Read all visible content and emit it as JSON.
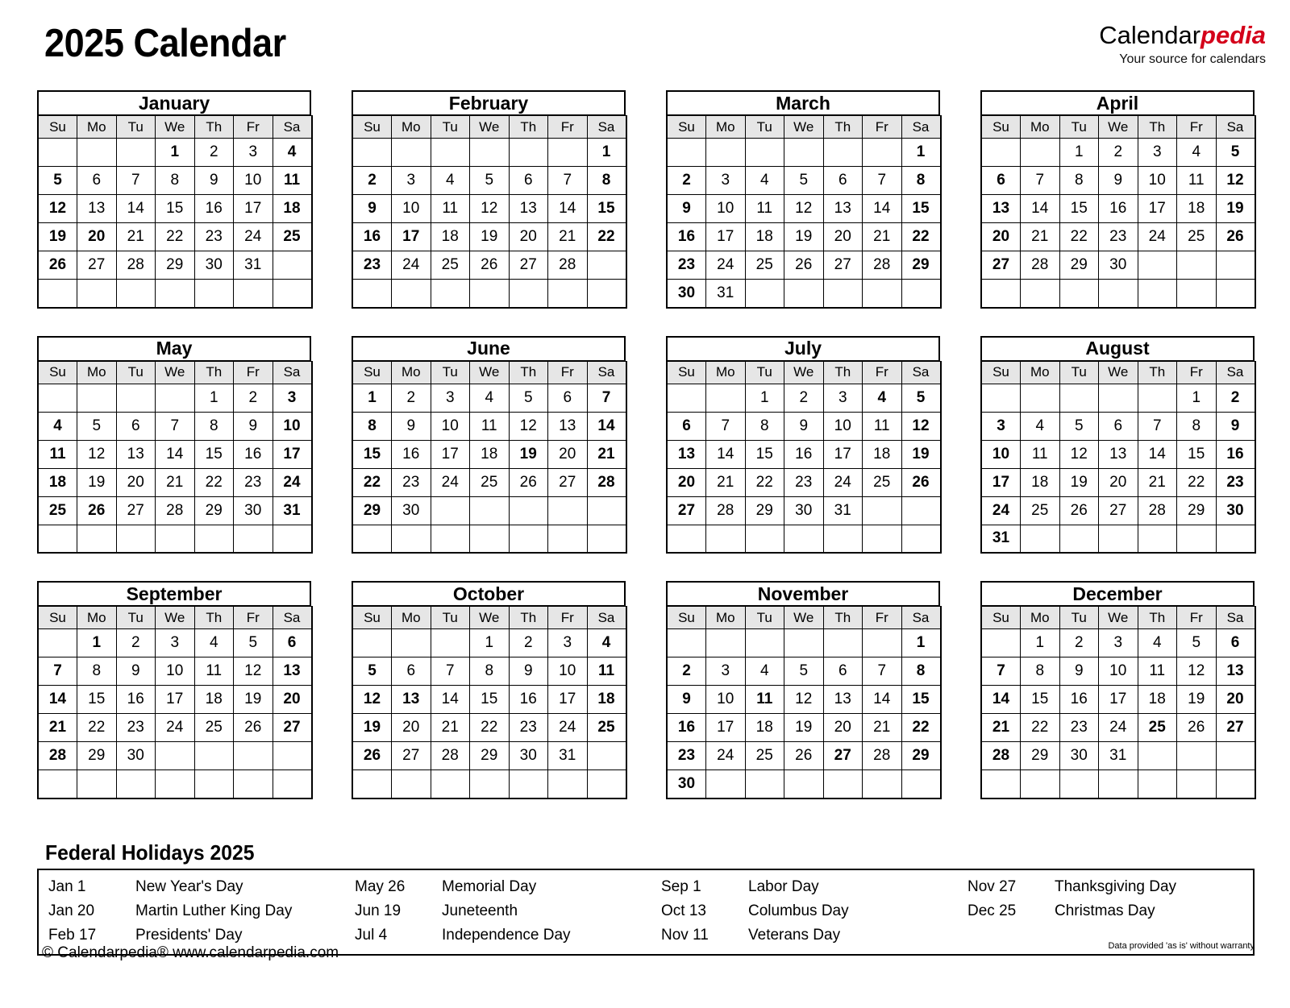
{
  "header": {
    "title": "2025 Calendar",
    "brand_primary": "Calendar",
    "brand_accent": "pedia",
    "brand_tagline": "Your source for calendars",
    "accent_color": "#d4001a"
  },
  "style_colors": {
    "sunday_bg": "#fac893",
    "saturday_bg": "#faf8d6",
    "weekday_header_bg": "#e6e6e6",
    "holiday_bg": "#fcdede",
    "holiday_text": "#cc0000",
    "border": "#000000"
  },
  "weekday_headers": [
    "Su",
    "Mo",
    "Tu",
    "We",
    "Th",
    "Fr",
    "Sa"
  ],
  "months": [
    {
      "name": "January",
      "weeks": [
        [
          "",
          "",
          "",
          "1",
          "2",
          "3",
          "4"
        ],
        [
          "5",
          "6",
          "7",
          "8",
          "9",
          "10",
          "11"
        ],
        [
          "12",
          "13",
          "14",
          "15",
          "16",
          "17",
          "18"
        ],
        [
          "19",
          "20",
          "21",
          "22",
          "23",
          "24",
          "25"
        ],
        [
          "26",
          "27",
          "28",
          "29",
          "30",
          "31",
          ""
        ],
        [
          "",
          "",
          "",
          "",
          "",
          "",
          ""
        ]
      ],
      "holidays": [
        "1",
        "20"
      ]
    },
    {
      "name": "February",
      "weeks": [
        [
          "",
          "",
          "",
          "",
          "",
          "",
          "1"
        ],
        [
          "2",
          "3",
          "4",
          "5",
          "6",
          "7",
          "8"
        ],
        [
          "9",
          "10",
          "11",
          "12",
          "13",
          "14",
          "15"
        ],
        [
          "16",
          "17",
          "18",
          "19",
          "20",
          "21",
          "22"
        ],
        [
          "23",
          "24",
          "25",
          "26",
          "27",
          "28",
          ""
        ],
        [
          "",
          "",
          "",
          "",
          "",
          "",
          ""
        ]
      ],
      "holidays": [
        "17"
      ]
    },
    {
      "name": "March",
      "weeks": [
        [
          "",
          "",
          "",
          "",
          "",
          "",
          "1"
        ],
        [
          "2",
          "3",
          "4",
          "5",
          "6",
          "7",
          "8"
        ],
        [
          "9",
          "10",
          "11",
          "12",
          "13",
          "14",
          "15"
        ],
        [
          "16",
          "17",
          "18",
          "19",
          "20",
          "21",
          "22"
        ],
        [
          "23",
          "24",
          "25",
          "26",
          "27",
          "28",
          "29"
        ],
        [
          "30",
          "31",
          "",
          "",
          "",
          "",
          ""
        ]
      ],
      "holidays": []
    },
    {
      "name": "April",
      "weeks": [
        [
          "",
          "",
          "1",
          "2",
          "3",
          "4",
          "5"
        ],
        [
          "6",
          "7",
          "8",
          "9",
          "10",
          "11",
          "12"
        ],
        [
          "13",
          "14",
          "15",
          "16",
          "17",
          "18",
          "19"
        ],
        [
          "20",
          "21",
          "22",
          "23",
          "24",
          "25",
          "26"
        ],
        [
          "27",
          "28",
          "29",
          "30",
          "",
          "",
          ""
        ],
        [
          "",
          "",
          "",
          "",
          "",
          "",
          ""
        ]
      ],
      "holidays": []
    },
    {
      "name": "May",
      "weeks": [
        [
          "",
          "",
          "",
          "",
          "1",
          "2",
          "3"
        ],
        [
          "4",
          "5",
          "6",
          "7",
          "8",
          "9",
          "10"
        ],
        [
          "11",
          "12",
          "13",
          "14",
          "15",
          "16",
          "17"
        ],
        [
          "18",
          "19",
          "20",
          "21",
          "22",
          "23",
          "24"
        ],
        [
          "25",
          "26",
          "27",
          "28",
          "29",
          "30",
          "31"
        ],
        [
          "",
          "",
          "",
          "",
          "",
          "",
          ""
        ]
      ],
      "holidays": [
        "26"
      ]
    },
    {
      "name": "June",
      "weeks": [
        [
          "1",
          "2",
          "3",
          "4",
          "5",
          "6",
          "7"
        ],
        [
          "8",
          "9",
          "10",
          "11",
          "12",
          "13",
          "14"
        ],
        [
          "15",
          "16",
          "17",
          "18",
          "19",
          "20",
          "21"
        ],
        [
          "22",
          "23",
          "24",
          "25",
          "26",
          "27",
          "28"
        ],
        [
          "29",
          "30",
          "",
          "",
          "",
          "",
          ""
        ],
        [
          "",
          "",
          "",
          "",
          "",
          "",
          ""
        ]
      ],
      "holidays": [
        "19"
      ]
    },
    {
      "name": "July",
      "weeks": [
        [
          "",
          "",
          "1",
          "2",
          "3",
          "4",
          "5"
        ],
        [
          "6",
          "7",
          "8",
          "9",
          "10",
          "11",
          "12"
        ],
        [
          "13",
          "14",
          "15",
          "16",
          "17",
          "18",
          "19"
        ],
        [
          "20",
          "21",
          "22",
          "23",
          "24",
          "25",
          "26"
        ],
        [
          "27",
          "28",
          "29",
          "30",
          "31",
          "",
          ""
        ],
        [
          "",
          "",
          "",
          "",
          "",
          "",
          ""
        ]
      ],
      "holidays": [
        "4"
      ]
    },
    {
      "name": "August",
      "weeks": [
        [
          "",
          "",
          "",
          "",
          "",
          "1",
          "2"
        ],
        [
          "3",
          "4",
          "5",
          "6",
          "7",
          "8",
          "9"
        ],
        [
          "10",
          "11",
          "12",
          "13",
          "14",
          "15",
          "16"
        ],
        [
          "17",
          "18",
          "19",
          "20",
          "21",
          "22",
          "23"
        ],
        [
          "24",
          "25",
          "26",
          "27",
          "28",
          "29",
          "30"
        ],
        [
          "31",
          "",
          "",
          "",
          "",
          "",
          ""
        ]
      ],
      "holidays": []
    },
    {
      "name": "September",
      "weeks": [
        [
          "",
          "1",
          "2",
          "3",
          "4",
          "5",
          "6"
        ],
        [
          "7",
          "8",
          "9",
          "10",
          "11",
          "12",
          "13"
        ],
        [
          "14",
          "15",
          "16",
          "17",
          "18",
          "19",
          "20"
        ],
        [
          "21",
          "22",
          "23",
          "24",
          "25",
          "26",
          "27"
        ],
        [
          "28",
          "29",
          "30",
          "",
          "",
          "",
          ""
        ],
        [
          "",
          "",
          "",
          "",
          "",
          "",
          ""
        ]
      ],
      "holidays": [
        "1"
      ]
    },
    {
      "name": "October",
      "weeks": [
        [
          "",
          "",
          "",
          "1",
          "2",
          "3",
          "4"
        ],
        [
          "5",
          "6",
          "7",
          "8",
          "9",
          "10",
          "11"
        ],
        [
          "12",
          "13",
          "14",
          "15",
          "16",
          "17",
          "18"
        ],
        [
          "19",
          "20",
          "21",
          "22",
          "23",
          "24",
          "25"
        ],
        [
          "26",
          "27",
          "28",
          "29",
          "30",
          "31",
          ""
        ],
        [
          "",
          "",
          "",
          "",
          "",
          "",
          ""
        ]
      ],
      "holidays": [
        "13"
      ]
    },
    {
      "name": "November",
      "weeks": [
        [
          "",
          "",
          "",
          "",
          "",
          "",
          "1"
        ],
        [
          "2",
          "3",
          "4",
          "5",
          "6",
          "7",
          "8"
        ],
        [
          "9",
          "10",
          "11",
          "12",
          "13",
          "14",
          "15"
        ],
        [
          "16",
          "17",
          "18",
          "19",
          "20",
          "21",
          "22"
        ],
        [
          "23",
          "24",
          "25",
          "26",
          "27",
          "28",
          "29"
        ],
        [
          "30",
          "",
          "",
          "",
          "",
          "",
          ""
        ]
      ],
      "holidays": [
        "11",
        "27"
      ]
    },
    {
      "name": "December",
      "weeks": [
        [
          "",
          "1",
          "2",
          "3",
          "4",
          "5",
          "6"
        ],
        [
          "7",
          "8",
          "9",
          "10",
          "11",
          "12",
          "13"
        ],
        [
          "14",
          "15",
          "16",
          "17",
          "18",
          "19",
          "20"
        ],
        [
          "21",
          "22",
          "23",
          "24",
          "25",
          "26",
          "27"
        ],
        [
          "28",
          "29",
          "30",
          "31",
          "",
          "",
          ""
        ],
        [
          "",
          "",
          "",
          "",
          "",
          "",
          ""
        ]
      ],
      "holidays": [
        "25"
      ]
    }
  ],
  "holidays_section": {
    "title": "Federal Holidays 2025",
    "columns": [
      [
        {
          "date": "Jan 1",
          "name": "New Year's Day"
        },
        {
          "date": "Jan 20",
          "name": "Martin Luther King Day"
        },
        {
          "date": "Feb 17",
          "name": "Presidents' Day"
        }
      ],
      [
        {
          "date": "May 26",
          "name": "Memorial Day"
        },
        {
          "date": "Jun 19",
          "name": "Juneteenth"
        },
        {
          "date": "Jul 4",
          "name": "Independence Day"
        }
      ],
      [
        {
          "date": "Sep 1",
          "name": "Labor Day"
        },
        {
          "date": "Oct 13",
          "name": "Columbus Day"
        },
        {
          "date": "Nov 11",
          "name": "Veterans Day"
        }
      ],
      [
        {
          "date": "Nov 27",
          "name": "Thanksgiving Day"
        },
        {
          "date": "Dec 25",
          "name": "Christmas Day"
        }
      ]
    ]
  },
  "footer": {
    "copyright": "© Calendarpedia®   www.calendarpedia.com",
    "disclaimer": "Data provided 'as is' without warranty"
  }
}
